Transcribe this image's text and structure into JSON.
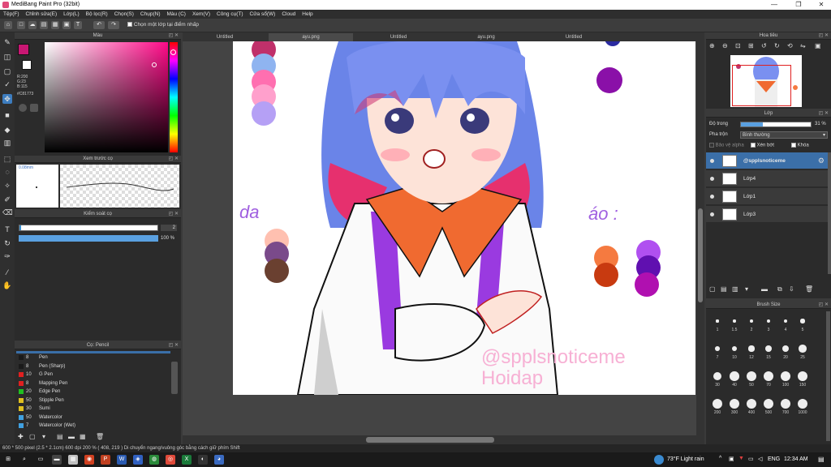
{
  "window": {
    "title": "MediBang Paint Pro (32bit)"
  },
  "menu": [
    "Tệp(F)",
    "Chỉnh sửa(E)",
    "Lớp(L)",
    "Bộ lọc(R)",
    "Chọn(S)",
    "Chụp(N)",
    "Màu (C)",
    "Xem(V)",
    "Công cụ(T)",
    "Cửa sổ(W)",
    "Cloud",
    "Help"
  ],
  "toolbar": {
    "select_layer_label": "Chọn một lớp tại điểm nhấp"
  },
  "color_panel": {
    "title": "Màu",
    "r": "R:200",
    "g": "G:23",
    "b": "B:115",
    "hex": "#C81773",
    "main_color": "#c81773"
  },
  "brush_preview": {
    "title": "Xem trước cọ",
    "size_label": "0.08mm"
  },
  "brush_control": {
    "title": "Kiểm soát cọ",
    "size_value": "2",
    "opacity_value": "100 %"
  },
  "brush_list": {
    "title": "Cọ: Pencil",
    "items": [
      {
        "size": "8",
        "name": "Pen",
        "color": "#1a1a1a"
      },
      {
        "size": "8",
        "name": "Pen (Sharp)",
        "color": "#1a1a1a"
      },
      {
        "size": "10",
        "name": "G Pen",
        "color": "#e02020"
      },
      {
        "size": "8",
        "name": "Mapping Pen",
        "color": "#e02020"
      },
      {
        "size": "20",
        "name": "Edge Pen",
        "color": "#20c020"
      },
      {
        "size": "50",
        "name": "Stipple Pen",
        "color": "#e0c020"
      },
      {
        "size": "30",
        "name": "Sumi",
        "color": "#e0c020"
      },
      {
        "size": "50",
        "name": "Watercolor",
        "color": "#40a0e0"
      },
      {
        "size": "7",
        "name": "Watercolor (Wet)",
        "color": "#40a0e0"
      }
    ]
  },
  "tabs": [
    "Untitled",
    "ayu.png",
    "Untitled",
    "ayu.png",
    "Untitled"
  ],
  "navigator": {
    "title": "Hoa tiêu"
  },
  "layer_panel": {
    "title": "Lớp",
    "opacity_label": "Độ trong",
    "opacity_value": "31 %",
    "blend_label": "Pha trộn",
    "blend_value": "Bình thường",
    "protect_alpha": "Bảo vệ alpha",
    "clipping": "Xén bớt",
    "lock": "Khóa",
    "layers": [
      {
        "name": "@spplsnoticeme",
        "selected": true
      },
      {
        "name": "Lớp4",
        "selected": false
      },
      {
        "name": "Lớp1",
        "selected": false
      },
      {
        "name": "Lớp3",
        "selected": false
      }
    ]
  },
  "brush_size": {
    "title": "Brush Size",
    "sizes": [
      "1",
      "1.5",
      "2",
      "3",
      "4",
      "5",
      "7",
      "10",
      "12",
      "15",
      "20",
      "25",
      "30",
      "40",
      "50",
      "70",
      "100",
      "150",
      "200",
      "300",
      "400",
      "500",
      "700",
      "1000"
    ]
  },
  "canvas_text": {
    "left_label": "da",
    "right_label": "áo :",
    "watermark_1": "@spplsnoticeme",
    "watermark_2": "Hoidap"
  },
  "status": {
    "text": "600 * 500 pixel   (2.5 * 2.1cm)   600 dpi   200 %   ( 408, 219 )   Di chuyển ngang/vuông góc bằng cách giữ phím Shift"
  },
  "taskbar": {
    "weather": "73°F  Light rain",
    "lang": "ENG",
    "time": "12:34 AM"
  }
}
